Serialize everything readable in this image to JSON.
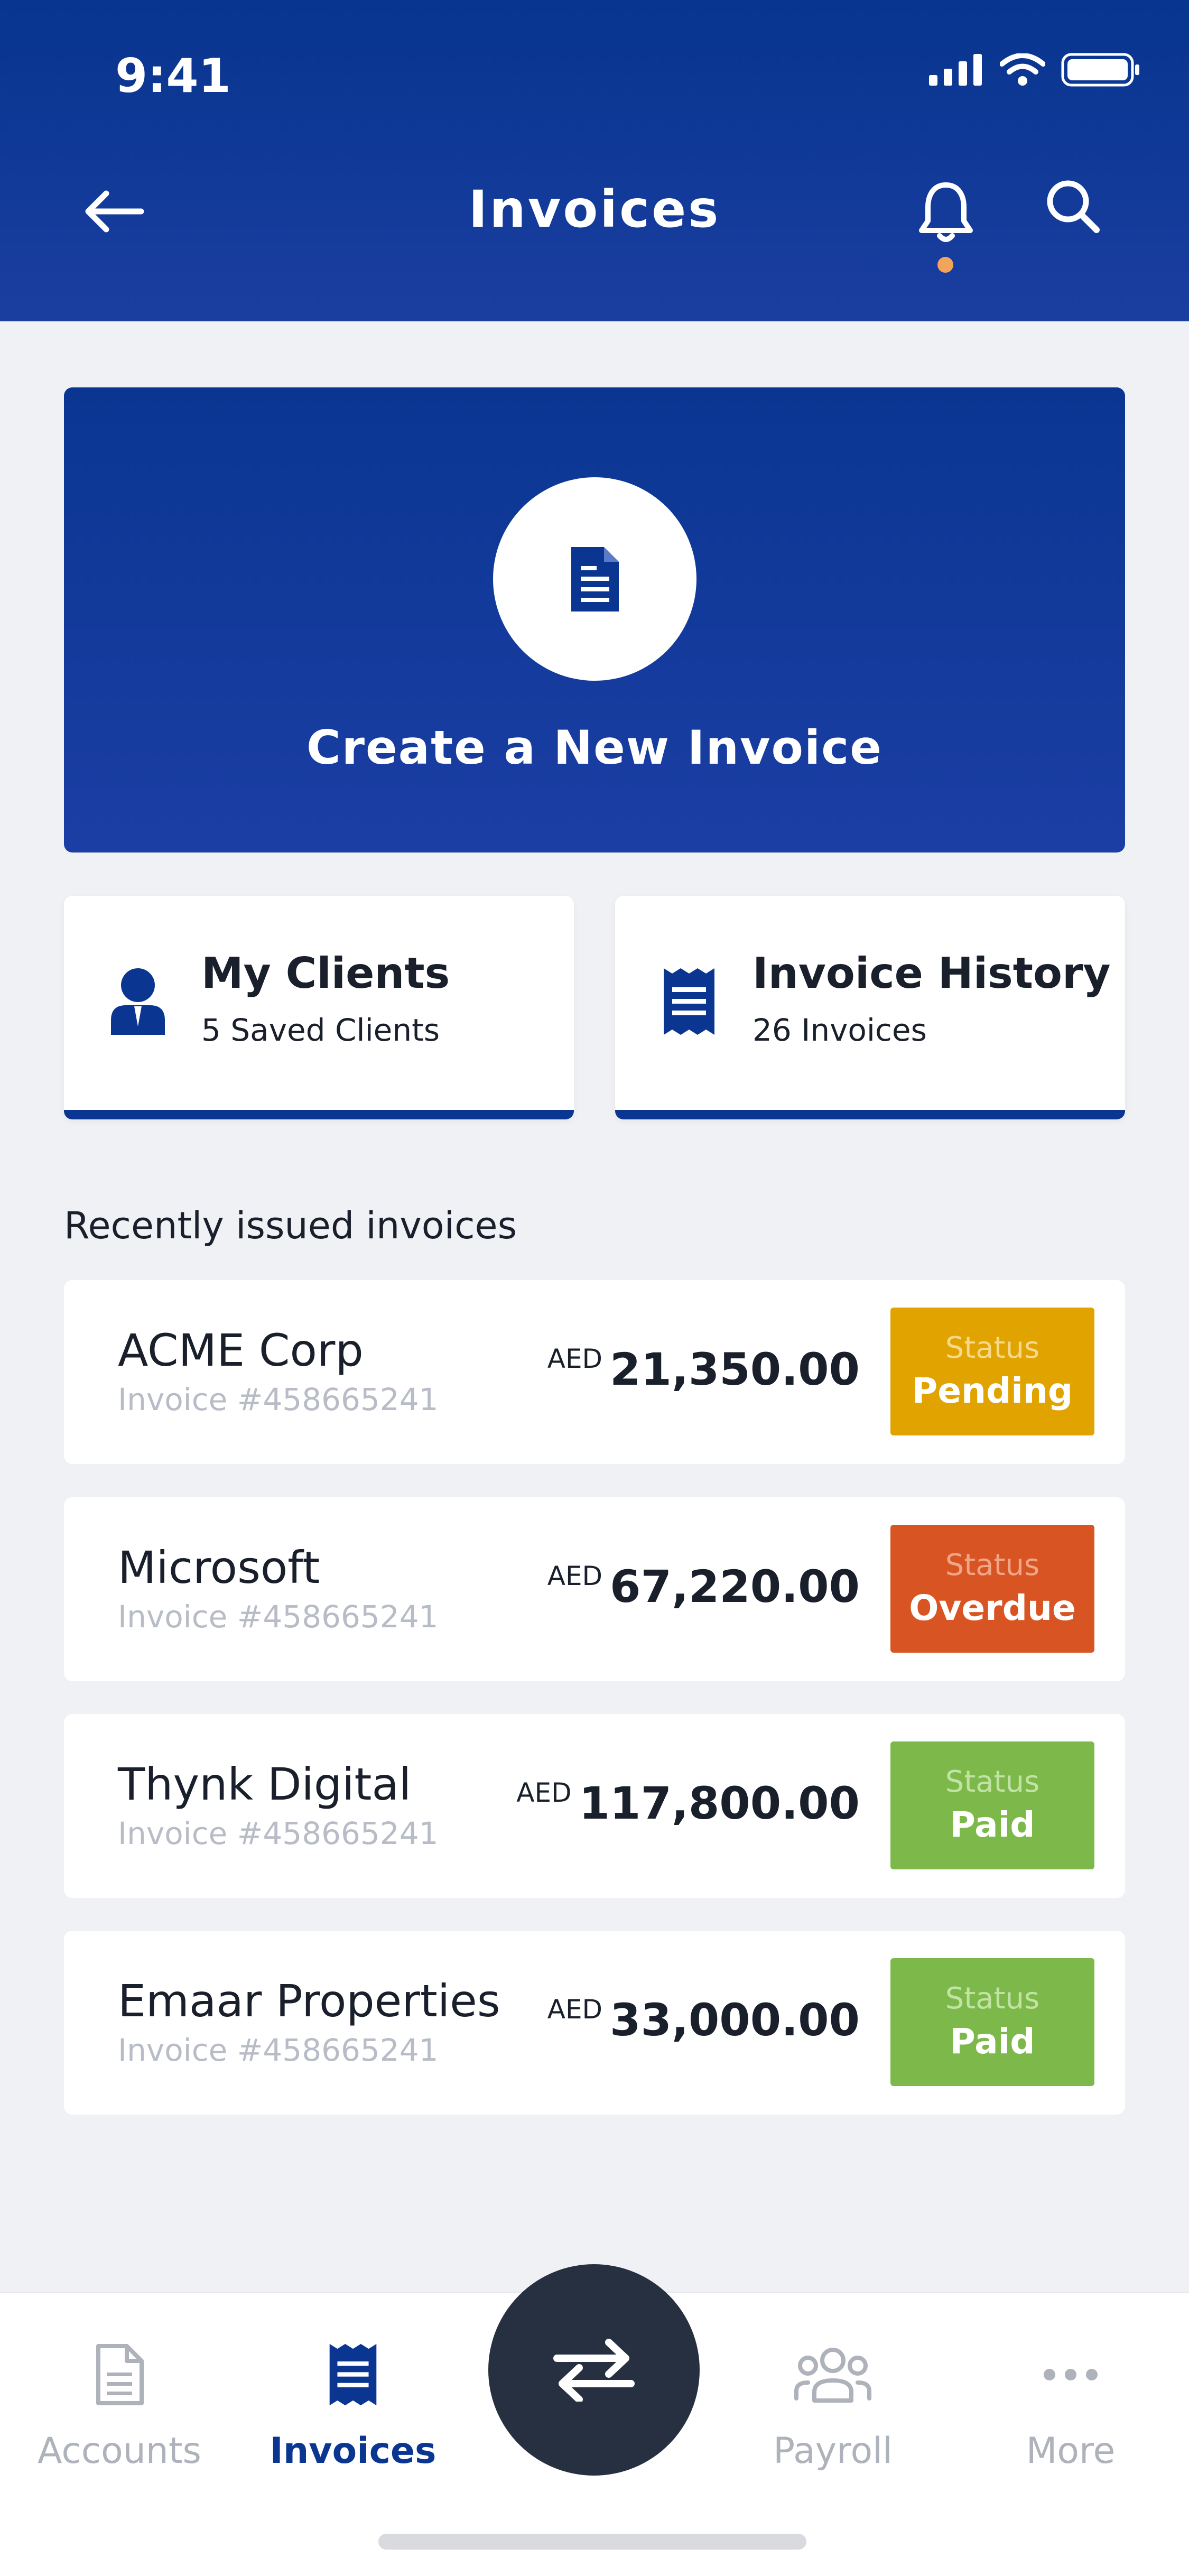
{
  "status_bar": {
    "time": "9:41"
  },
  "header": {
    "title": "Invoices",
    "back_icon": "arrow-left-icon",
    "bell_icon": "bell-icon",
    "search_icon": "search-icon",
    "notification_dot_color": "#f3a45b"
  },
  "create_card": {
    "label": "Create a New Invoice",
    "icon": "invoice-document-icon"
  },
  "quick_cards": [
    {
      "title": "My Clients",
      "subtitle": "5 Saved Clients",
      "icon": "client-person-icon"
    },
    {
      "title": "Invoice History",
      "subtitle": "26 Invoices",
      "icon": "receipt-icon"
    }
  ],
  "recent": {
    "section_label": "Recently issued invoices",
    "invoices": [
      {
        "client": "ACME Corp",
        "number": "Invoice #458665241",
        "currency": "AED",
        "amount": "21,350.00",
        "status_label": "Status",
        "status": "Pending",
        "status_color": "#e0a300"
      },
      {
        "client": "Microsoft",
        "number": "Invoice #458665241",
        "currency": "AED",
        "amount": "67,220.00",
        "status_label": "Status",
        "status": "Overdue",
        "status_color": "#d85523"
      },
      {
        "client": "Thynk Digital",
        "number": "Invoice #458665241",
        "currency": "AED",
        "amount": "117,800.00",
        "status_label": "Status",
        "status": "Paid",
        "status_color": "#7db94a"
      },
      {
        "client": "Emaar Properties",
        "number": "Invoice #458665241",
        "currency": "AED",
        "amount": "33,000.00",
        "status_label": "Status",
        "status": "Paid",
        "status_color": "#7db94a"
      }
    ]
  },
  "tabbar": {
    "tabs": [
      {
        "label": "Accounts",
        "icon": "document-icon",
        "active": false
      },
      {
        "label": "Invoices",
        "icon": "receipt-icon",
        "active": true
      },
      {
        "label": "Payroll",
        "icon": "people-group-icon",
        "active": false
      },
      {
        "label": "More",
        "icon": "more-dots-icon",
        "active": false
      }
    ],
    "fab_icon": "transfer-arrows-icon"
  },
  "colors": {
    "brand": "#0a3692",
    "active_tab": "#0a3692",
    "inactive_tab": "#aeb2bb"
  }
}
